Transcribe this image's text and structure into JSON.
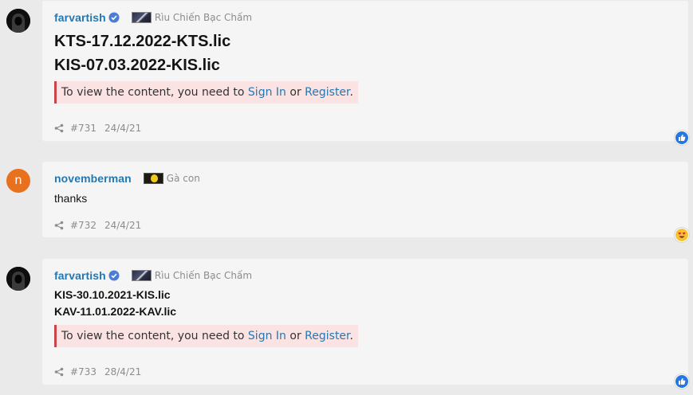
{
  "posts": [
    {
      "username": "farvartish",
      "user_title": "Rìu Chiến Bạc Chấm",
      "lines": [
        "KTS-17.12.2022-KTS.lic",
        "KIS-07.03.2022-KIS.lic"
      ],
      "notice": {
        "prefix": "To view the content, you need to ",
        "sign_in": "Sign In",
        "or": " or ",
        "register": "Register",
        "suffix": "."
      },
      "post_number": "#731",
      "date": "24/4/21",
      "reaction": "like-icon"
    },
    {
      "username": "novemberman",
      "avatar_letter": "n",
      "user_title": "Gà con",
      "text": "thanks",
      "post_number": "#732",
      "date": "24/4/21",
      "reaction": "heart-eyes-icon"
    },
    {
      "username": "farvartish",
      "user_title": "Rìu Chiến Bạc Chấm",
      "lines": [
        "KIS-30.10.2021-KIS.lic",
        "KAV-11.01.2022-KAV.lic"
      ],
      "notice": {
        "prefix": "To view the content, you need to ",
        "sign_in": "Sign In",
        "or": " or ",
        "register": "Register",
        "suffix": "."
      },
      "post_number": "#733",
      "date": "28/4/21",
      "reaction": "like-icon"
    }
  ],
  "colors": {
    "username": "#2577b1",
    "notice_bg": "#fbe3e4",
    "notice_border": "#c84448",
    "avatar_orange": "#e8711e"
  }
}
